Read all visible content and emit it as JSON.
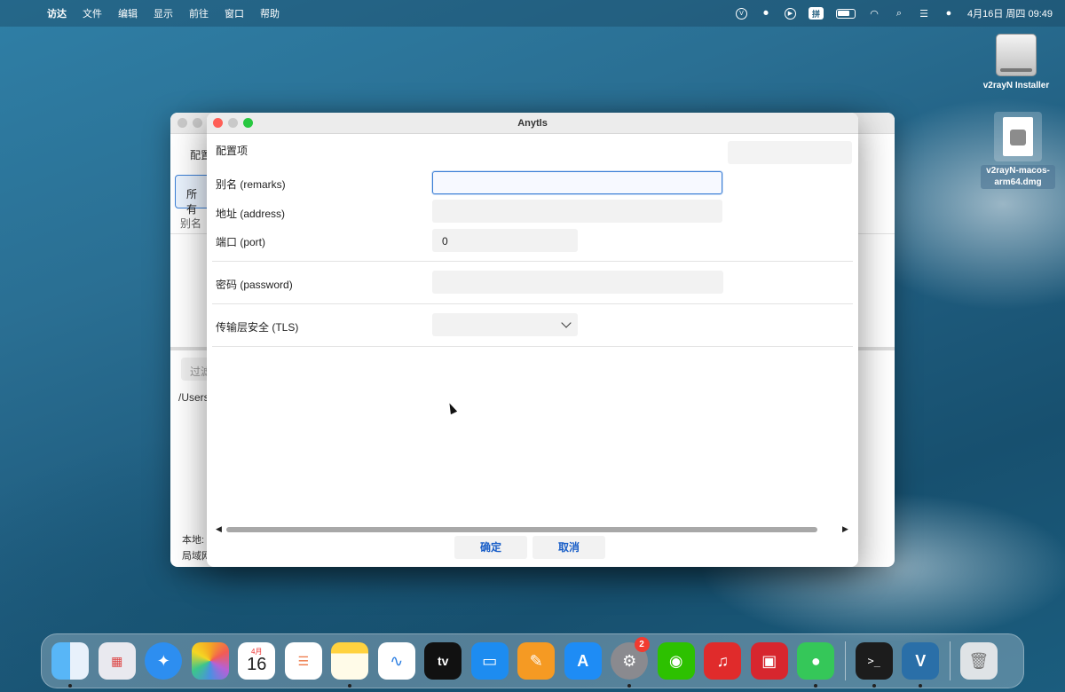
{
  "menubar": {
    "app_name": "访达",
    "items": [
      "文件",
      "编辑",
      "显示",
      "前往",
      "窗口",
      "帮助"
    ],
    "input_method": "拼",
    "datetime": "4月16日 周四  09:49"
  },
  "desktop": {
    "icons": [
      {
        "label": "v2rayN Installer"
      },
      {
        "label": "v2rayN-macos-arm64.dmg"
      }
    ]
  },
  "bg_window": {
    "text_config": "配置",
    "tab_all": "所有",
    "col_alias": "别名",
    "filter_placeholder": "过滤",
    "path_text": "/Users",
    "status_local": "本地:",
    "status_lan": "局域网"
  },
  "dialog": {
    "title": "Anytls",
    "section_title": "配置项",
    "fields": {
      "remarks_label": "别名 (remarks)",
      "remarks_value": "",
      "address_label": "地址 (address)",
      "address_value": "",
      "port_label": "端口 (port)",
      "port_value": "0",
      "password_label": "密码 (password)",
      "password_value": "",
      "tls_label": "传输层安全 (TLS)",
      "tls_value": ""
    },
    "more_icon": "⋮",
    "ok_label": "确定",
    "cancel_label": "取消"
  },
  "dock": {
    "apps": [
      {
        "name": "Finder",
        "icon": "finder-icon",
        "color": "#3a8ff0"
      },
      {
        "name": "Launchpad",
        "icon": "launchpad-icon",
        "color": "#e9e9ef"
      },
      {
        "name": "Safari",
        "icon": "safari-icon",
        "color": "#2d8ef0"
      },
      {
        "name": "Photos",
        "icon": "photos-icon",
        "color": "#ffffff"
      },
      {
        "name": "Calendar",
        "icon": "calendar-icon",
        "month": "4月",
        "day": "16"
      },
      {
        "name": "Reminders",
        "icon": "reminders-icon",
        "color": "#ffffff"
      },
      {
        "name": "Notes",
        "icon": "notes-icon",
        "color": "#ffd23f"
      },
      {
        "name": "Freeform",
        "icon": "freeform-icon",
        "color": "#ffffff"
      },
      {
        "name": "TV",
        "icon": "tv-icon",
        "label": "tv",
        "color": "#111111"
      },
      {
        "name": "Keynote",
        "icon": "keynote-icon",
        "color": "#1d8cf0"
      },
      {
        "name": "Pages",
        "icon": "pages-icon",
        "color": "#f59a23"
      },
      {
        "name": "App Store",
        "icon": "appstore-icon",
        "color": "#1e8cf5"
      },
      {
        "name": "System Settings",
        "icon": "settings-icon",
        "color": "#8a8a8f",
        "badge": "2"
      },
      {
        "name": "WeChat",
        "icon": "wechat-icon",
        "color": "#2dc100"
      },
      {
        "name": "NetEase Music",
        "icon": "netease-music-icon",
        "color": "#e02b2b"
      },
      {
        "name": "Photo Booth",
        "icon": "photobooth-icon",
        "color": "#d7262e"
      },
      {
        "name": "Messages",
        "icon": "messages-icon",
        "color": "#35c759"
      },
      {
        "name": "Terminal",
        "icon": "terminal-icon",
        "color": "#1c1c1c"
      },
      {
        "name": "v2rayN",
        "icon": "v2rayn-icon",
        "color": "#2a6fa8"
      },
      {
        "name": "Trash",
        "icon": "trash-icon",
        "color": "#dfe3e6"
      }
    ]
  }
}
